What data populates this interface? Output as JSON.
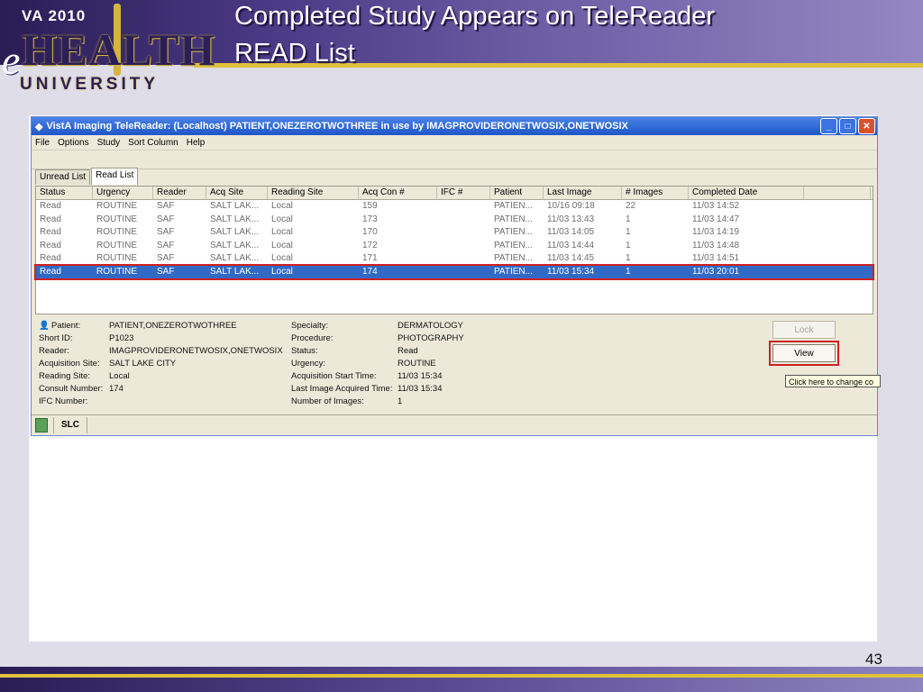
{
  "slide": {
    "title_line1": "Completed Study Appears on TeleReader",
    "title_line2": "READ List",
    "page_number": "43",
    "logo": {
      "va_text": "VA 2010",
      "health_text": "HEALTH",
      "e_text": "e",
      "university_text": "UNIVERSITY"
    }
  },
  "window": {
    "title": "VistA Imaging TeleReader: (Localhost) PATIENT,ONEZEROTWOTHREE in use by IMAGPROVIDERONETWOSIX,ONETWOSIX",
    "menu": [
      "File",
      "Options",
      "Study",
      "Sort Column",
      "Help"
    ],
    "tabs": [
      {
        "label": "Unread List",
        "active": false
      },
      {
        "label": "Read List",
        "active": true
      }
    ],
    "columns": [
      "Status",
      "Urgency",
      "Reader",
      "Acq Site",
      "Reading Site",
      "Acq Con #",
      "IFC #",
      "Patient",
      "Last Image",
      "# Images",
      "Completed Date",
      ""
    ],
    "rows": [
      [
        "Read",
        "ROUTINE",
        "SAF",
        "SALT LAK...",
        "Local",
        "159",
        "",
        "PATIEN...",
        "10/16 09:18",
        "22",
        "11/03 14:52"
      ],
      [
        "Read",
        "ROUTINE",
        "SAF",
        "SALT LAK...",
        "Local",
        "173",
        "",
        "PATIEN...",
        "11/03 13:43",
        "1",
        "11/03 14:47"
      ],
      [
        "Read",
        "ROUTINE",
        "SAF",
        "SALT LAK...",
        "Local",
        "170",
        "",
        "PATIEN...",
        "11/03 14:05",
        "1",
        "11/03 14:19"
      ],
      [
        "Read",
        "ROUTINE",
        "SAF",
        "SALT LAK...",
        "Local",
        "172",
        "",
        "PATIEN...",
        "11/03 14:44",
        "1",
        "11/03 14:48"
      ],
      [
        "Read",
        "ROUTINE",
        "SAF",
        "SALT LAK...",
        "Local",
        "171",
        "",
        "PATIEN...",
        "11/03 14:45",
        "1",
        "11/03 14:51"
      ],
      [
        "Read",
        "ROUTINE",
        "SAF",
        "SALT LAK...",
        "Local",
        "174",
        "",
        "PATIEN...",
        "11/03 15:34",
        "1",
        "11/03 20:01"
      ]
    ],
    "selected_row": 5,
    "details": {
      "patient_label": "Patient:",
      "patient": "PATIENT,ONEZEROTWOTHREE",
      "shortid_label": "Short ID:",
      "shortid": "P1023",
      "reader_label": "Reader:",
      "reader": "IMAGPROVIDERONETWOSIX,ONETWOSIX",
      "acqsite_label": "Acquisition Site:",
      "acqsite": "SALT LAKE CITY",
      "readsite_label": "Reading Site:",
      "readsite": "Local",
      "consult_label": "Consult Number:",
      "consult": "174",
      "ifc_label": "IFC Number:",
      "ifc": "",
      "specialty_label": "Specialty:",
      "specialty": "DERMATOLOGY",
      "procedure_label": "Procedure:",
      "procedure": "PHOTOGRAPHY",
      "status_label": "Status:",
      "status": "Read",
      "urgency_label": "Urgency:",
      "urgency": "ROUTINE",
      "acqstart_label": "Acquisition Start Time:",
      "acqstart": "11/03 15:34",
      "lastimg_label": "Last Image Acquired Time:",
      "lastimg": "11/03 15:34",
      "numimg_label": "Number of Images:",
      "numimg": "1"
    },
    "buttons": {
      "lock": "Lock",
      "view": "View"
    },
    "tooltip": "Click here to change co",
    "status_site": "SLC",
    "title_buttons": [
      "_",
      "□",
      "✕"
    ]
  }
}
